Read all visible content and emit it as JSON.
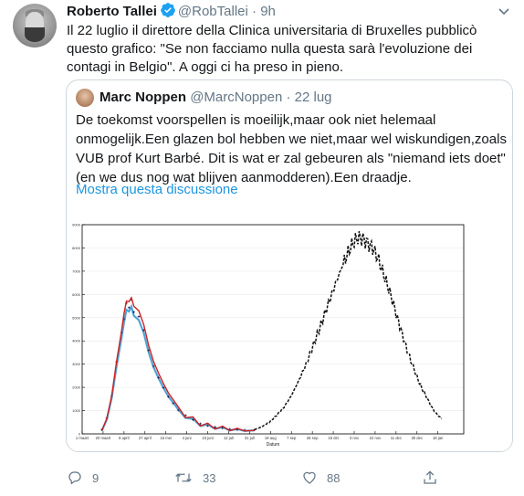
{
  "tweet": {
    "author_name": "Roberto Tallei",
    "handle": "@RobTallei",
    "dot": "·",
    "time": "9h",
    "text": "Il 22 luglio il direttore della Clinica universitaria di Bruxelles pubblicò questo grafico: \"Se non facciamo nulla questa sarà l'evoluzione dei contagi in Belgio\". A oggi ci ha preso in pieno.",
    "actions": {
      "replies": "9",
      "retweets": "33",
      "likes": "88"
    }
  },
  "quoted_tweet": {
    "author_name": "Marc Noppen",
    "handle": "@MarcNoppen",
    "dot": "·",
    "time": "22 lug",
    "text": "De toekomst voorspellen is moeilijk,maar ook niet helemaal onmogelijk.Een glazen bol hebben we niet,maar wel wiskundigen,zoals VUB prof Kurt Barbé. Dit is wat er zal gebeuren als \"niemand iets doet\" (en we dus nog wat blijven aanmodderen).Een draadje.",
    "show_thread": "Mostra questa discussione"
  },
  "chart_data": {
    "type": "line",
    "xlabel": "Datum",
    "ylim": [
      0,
      9000
    ],
    "y_ticks": [
      "0",
      "1000",
      "2000",
      "3000",
      "4000",
      "5000",
      "6000",
      "7000",
      "8000",
      "9000"
    ],
    "x_ticks": [
      "1 maart",
      "20 maart",
      "8 april",
      "27 april",
      "16 mei",
      "4 juni",
      "23 juni",
      "12 juli",
      "31 juli",
      "19 aug",
      "7 sep",
      "26 sep",
      "15 okt",
      "3 nov",
      "22 nov",
      "11 dec",
      "30 dec",
      "18 jan"
    ],
    "colors": {
      "observed": "#cc2222",
      "fit_dark": "#1a1a4a",
      "fit_light": "#4fa3d9",
      "projection": "#111111"
    },
    "series": [
      {
        "style": "solid-red",
        "values": [
          [
            8,
            180
          ],
          [
            10,
            700
          ],
          [
            12,
            1700
          ],
          [
            14,
            3200
          ],
          [
            16,
            4500
          ],
          [
            17,
            5100
          ],
          [
            18,
            5800
          ],
          [
            19,
            5600
          ],
          [
            20,
            5950
          ],
          [
            21,
            5400
          ],
          [
            23,
            5200
          ],
          [
            25,
            4600
          ],
          [
            27,
            3700
          ],
          [
            29,
            3000
          ],
          [
            31,
            2500
          ],
          [
            33,
            2050
          ],
          [
            35,
            1650
          ],
          [
            37,
            1350
          ],
          [
            39,
            1050
          ],
          [
            42,
            820
          ],
          [
            45,
            620
          ],
          [
            48,
            450
          ],
          [
            51,
            360
          ],
          [
            54,
            300
          ],
          [
            57,
            250
          ],
          [
            60,
            210
          ],
          [
            63,
            180
          ],
          [
            66,
            170
          ],
          [
            70,
            180
          ]
        ]
      },
      {
        "style": "dashed-black",
        "values": [
          [
            70,
            180
          ],
          [
            73,
            300
          ],
          [
            76,
            500
          ],
          [
            79,
            800
          ],
          [
            82,
            1150
          ],
          [
            85,
            1650
          ],
          [
            88,
            2300
          ],
          [
            91,
            3000
          ],
          [
            94,
            3850
          ],
          [
            97,
            4700
          ],
          [
            100,
            5600
          ],
          [
            103,
            6500
          ],
          [
            106,
            7300
          ],
          [
            108,
            7800
          ],
          [
            110,
            8200
          ],
          [
            112,
            8450
          ],
          [
            114,
            8400
          ],
          [
            116,
            8200
          ],
          [
            118,
            8000
          ],
          [
            120,
            7600
          ],
          [
            122,
            7000
          ],
          [
            124,
            6400
          ],
          [
            126,
            5750
          ],
          [
            128,
            5000
          ],
          [
            130,
            4300
          ],
          [
            132,
            3600
          ],
          [
            134,
            3000
          ],
          [
            136,
            2450
          ],
          [
            138,
            1950
          ],
          [
            140,
            1550
          ],
          [
            142,
            1150
          ],
          [
            144,
            850
          ],
          [
            146,
            650
          ]
        ]
      }
    ]
  }
}
